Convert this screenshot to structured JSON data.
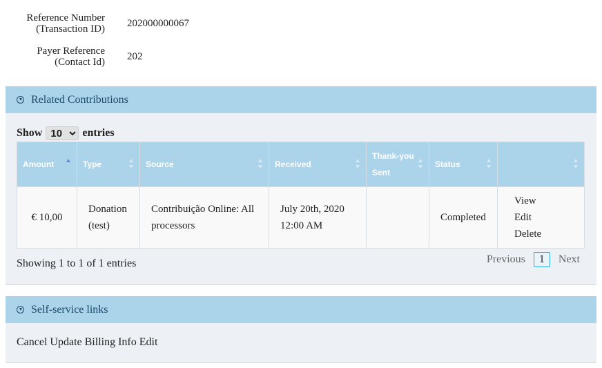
{
  "info": {
    "reference_label_1": "Reference Number",
    "reference_label_2": "(Transaction ID)",
    "reference_value": "202000000067",
    "payer_label_1": "Payer Reference",
    "payer_label_2": "(Contact Id)",
    "payer_value": "202"
  },
  "related": {
    "title": "Related Contributions",
    "show_label": "Show",
    "page_size": "10",
    "entries_label": "entries",
    "columns": [
      "Amount",
      "Type",
      "Source",
      "Received",
      "Thank-you Sent",
      "Status",
      ""
    ],
    "rows": [
      {
        "amount": "€ 10,00",
        "type": "Donation (test)",
        "source": "Contribuição Online: All processors",
        "received": "July 20th, 2020 12:00 AM",
        "thankyou": "",
        "status": "Completed",
        "actions": [
          "View",
          "Edit",
          "Delete"
        ]
      }
    ],
    "showing_text": "Showing 1 to 1 of 1 entries",
    "pager": {
      "previous": "Previous",
      "current_page": "1",
      "next": "Next"
    }
  },
  "selfservice": {
    "title": "Self-service links",
    "links": [
      "Cancel",
      "Update Billing Info",
      "Edit"
    ]
  }
}
